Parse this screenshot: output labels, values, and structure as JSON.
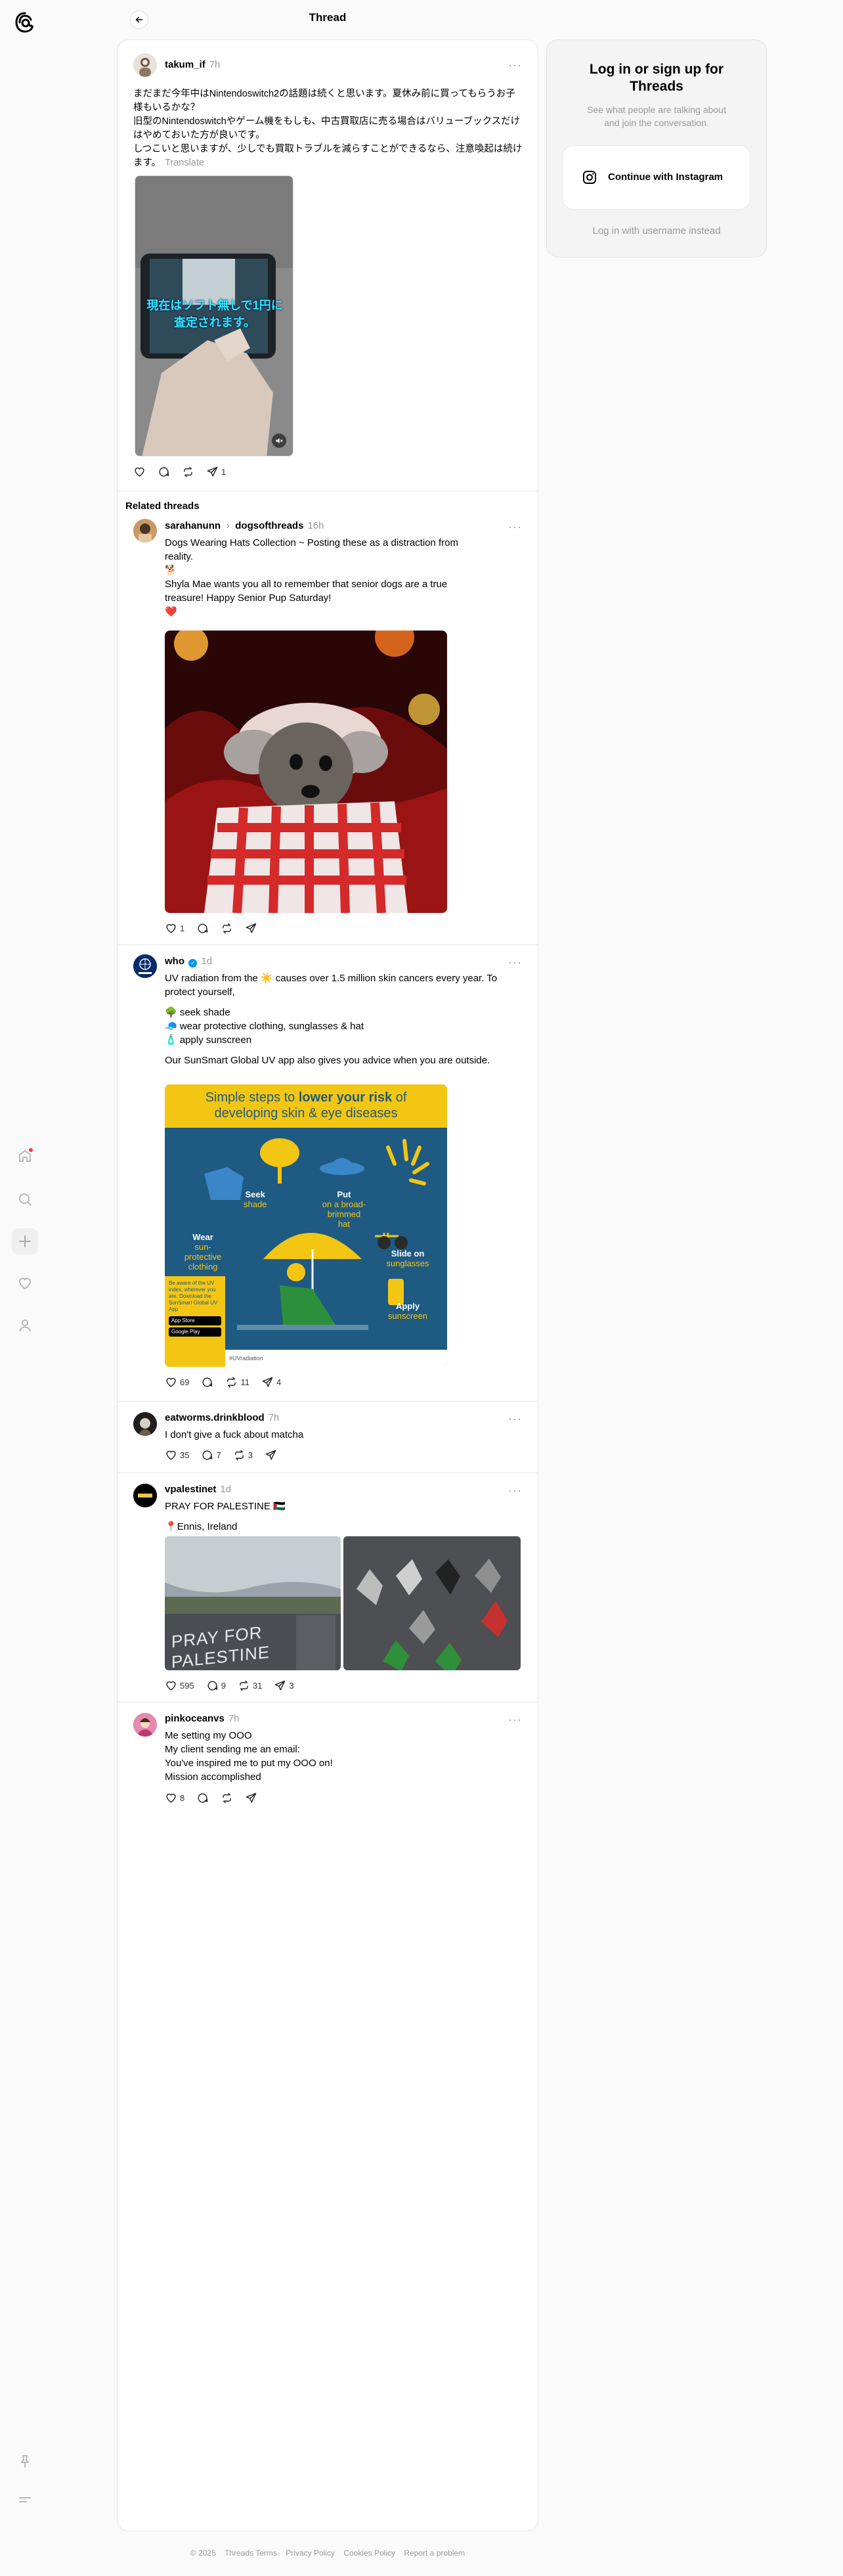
{
  "header": {
    "title": "Thread"
  },
  "main_post": {
    "username": "takum_if",
    "time": "7h",
    "text": "まだまだ今年中はNintendoswitch2の話題は続くと思います。夏休み前に買ってもらうお子様もいるかな？\n旧型のNintendoswitchやゲーム機をもしも、中古買取店に売る場合はバリューブックスだけはやめておいた方が良いです。\nしつこいと思いますが、少しでも買取トラブルを減らすことができるなら、注意喚起は続けます。",
    "translate_label": "Translate",
    "video_caption": "現在はソフト無しで1円に査定されます。",
    "repost_count": "1"
  },
  "related_heading": "Related threads",
  "related": [
    {
      "username": "sarahanunn",
      "coauthor": "dogsofthreads",
      "time": "16h",
      "paragraphs": [
        "Dogs Wearing Hats Collection ~ Posting these as a distraction from reality.",
        "🐕",
        "Shyla Mae wants you all to remember that senior dogs are a true treasure! Happy Senior Pup Saturday!",
        "❤️"
      ],
      "likes": "1",
      "replies": "",
      "reposts": "",
      "shares": ""
    },
    {
      "username": "who",
      "verified": true,
      "time": "1d",
      "paragraphs": [
        "UV radiation from the ☀️ causes over 1.5 million skin cancers every year. To protect yourself,",
        "🌳 seek shade\n🧢 wear protective clothing, sunglasses & hat\n🧴 apply sunscreen",
        "Our SunSmart Global UV app also gives you advice when you are outside."
      ],
      "infographic": {
        "title_prefix": "Simple steps to ",
        "title_bold": "lower your risk",
        "title_suffix": " of developing skin & eye diseases",
        "seek": "Seek",
        "seek_sub": "shade",
        "put": "Put",
        "put_sub": "on a broad-brimmed hat",
        "wear": "Wear",
        "wear_sub": "sun-protective clothing",
        "slide": "Slide on",
        "slide_sub": "sunglasses",
        "apply": "Apply",
        "apply_sub": "sunscreen",
        "aware": "Be aware of the UV index, wherever you are. Download the SunSmart Global UV App",
        "appstore": "App Store",
        "googleplay": "Google Play",
        "hashtag": "#UVradiation"
      },
      "likes": "69",
      "replies": "",
      "reposts": "11",
      "shares": "4"
    },
    {
      "username": "eatworms.drinkblood",
      "time": "7h",
      "paragraphs": [
        "I don't give a fuck about matcha"
      ],
      "likes": "35",
      "replies": "7",
      "reposts": "3",
      "shares": ""
    },
    {
      "username": "vpalestinet",
      "time": "1d",
      "paragraphs": [
        "PRAY FOR PALESTINE 🇵🇸",
        "📍Ennis, Ireland"
      ],
      "photo_text": "PRAY FOR PALESTINE",
      "likes": "595",
      "replies": "9",
      "reposts": "31",
      "shares": "3"
    },
    {
      "username": "pinkoceanvs",
      "time": "7h",
      "paragraphs": [
        "Me setting my OOO\nMy client sending me an email:\nYou've inspired me to put my OOO on!\nMission accomplished"
      ],
      "likes": "8",
      "replies": "",
      "reposts": "",
      "shares": ""
    }
  ],
  "login": {
    "title": "Log in or sign up for Threads",
    "subtitle": "See what people are talking about and join the conversation.",
    "instagram_button": "Continue with Instagram",
    "alt_login": "Log in with username instead"
  },
  "footer": [
    "© 2025",
    "Threads Terms",
    "Privacy Policy",
    "Cookies Policy",
    "Report a problem"
  ],
  "colors": {
    "accent": "#000000",
    "muted": "#999999",
    "notification_dot": "#ff3040",
    "verified": "#0095f6"
  }
}
